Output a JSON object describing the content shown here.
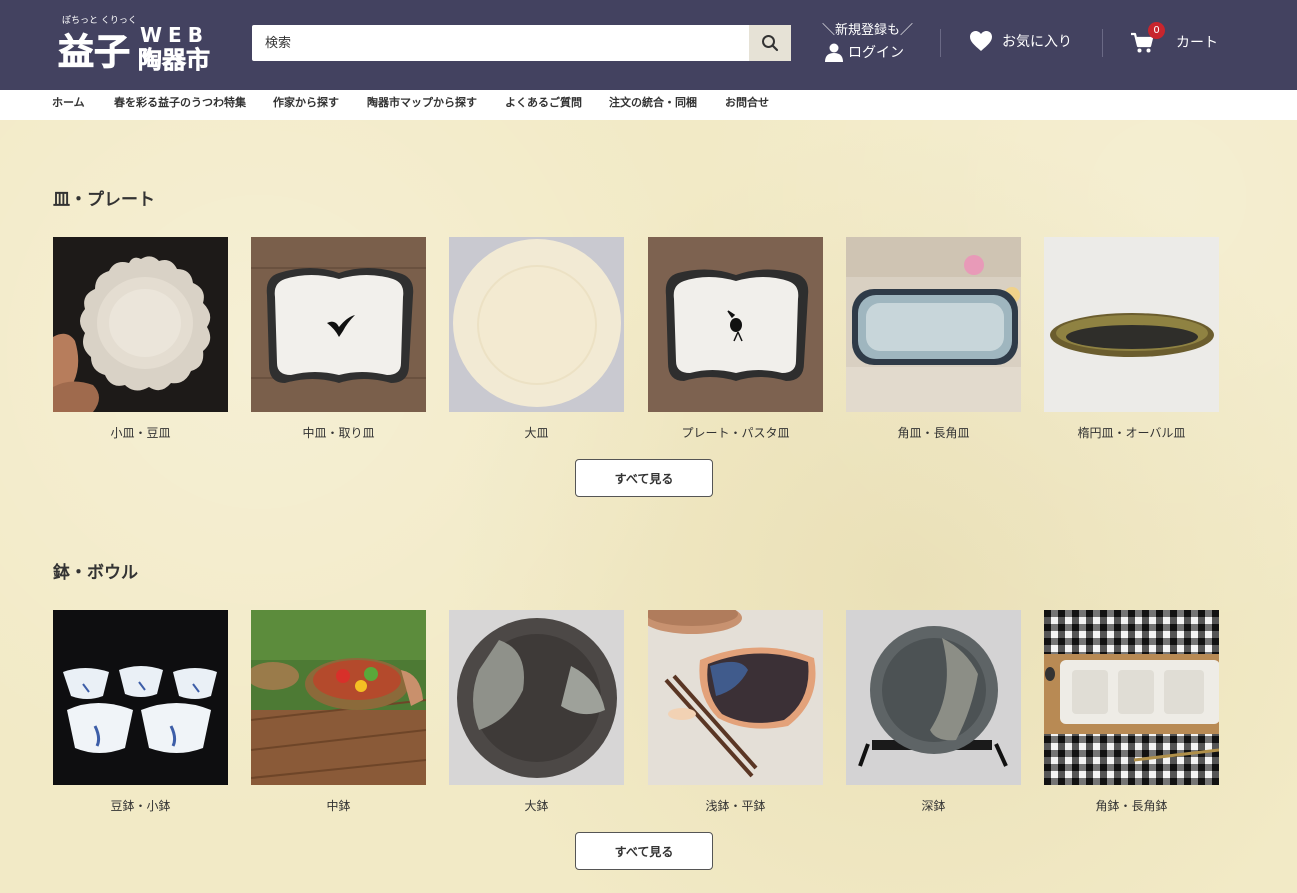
{
  "header": {
    "logo_ruby": "ぽちっと くりっく",
    "logo_main_left": "益子",
    "logo_web": "WEB",
    "logo_main_right": "陶器市",
    "search_placeholder": "検索",
    "register_top": "＼新規登録も／",
    "login_label": "ログイン",
    "favorites_label": "お気に入り",
    "cart_label": "カート",
    "cart_count": "0",
    "bg_color": "#434260"
  },
  "nav": {
    "items": [
      "ホーム",
      "春を彩る益子のうつわ特集",
      "作家から探す",
      "陶器市マップから探す",
      "よくあるご質問",
      "注文の統合・同梱",
      "お問合せ"
    ]
  },
  "sections": [
    {
      "title": "皿・プレート",
      "items": [
        "小皿・豆皿",
        "中皿・取り皿",
        "大皿",
        "プレート・パスタ皿",
        "角皿・長角皿",
        "楕円皿・オーバル皿"
      ],
      "see_all": "すべて見る"
    },
    {
      "title": "鉢・ボウル",
      "items": [
        "豆鉢・小鉢",
        "中鉢",
        "大鉢",
        "浅鉢・平鉢",
        "深鉢",
        "角鉢・長角鉢"
      ],
      "see_all": "すべて見る"
    }
  ],
  "colors": {
    "page_bg": "#f2eac6",
    "cart_badge": "#c8252d"
  }
}
